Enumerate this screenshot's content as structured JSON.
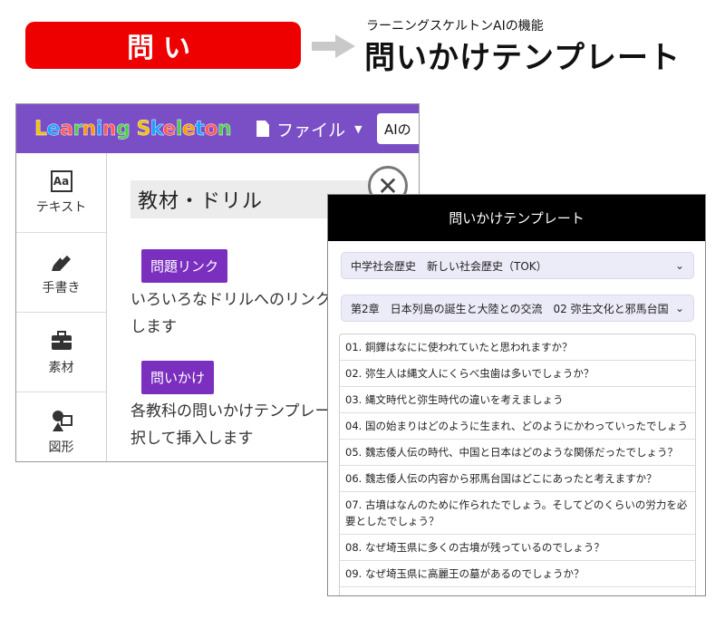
{
  "banner": {
    "pill_label": "問い",
    "subtitle": "ラーニングスケルトンAIの機能",
    "title": "問いかけテンプレート",
    "pill_color": "#ee0000"
  },
  "app": {
    "logo_letters": [
      "L",
      "e",
      "a",
      "r",
      "n",
      "i",
      "n",
      "g",
      " ",
      "S",
      "k",
      "e",
      "l",
      "e",
      "t",
      "o",
      "n"
    ],
    "logo_colors": [
      "#f2c200",
      "#1ea3ff",
      "#ff5a5a",
      "#4cd04c",
      "#ff9b00",
      "#1ea3ff",
      "#ff5a5a",
      "#4cd04c",
      "#ffffff",
      "#f2c200",
      "#1ea3ff",
      "#ff5a5a",
      "#4cd04c",
      "#ff9b00",
      "#1ea3ff",
      "#ff5a5a",
      "#4cd04c"
    ],
    "file_menu": "ファイル",
    "ai_box": "AIの",
    "sidebar": [
      {
        "label": "テキスト",
        "icon": "text-aa-icon"
      },
      {
        "label": "手書き",
        "icon": "pen-icon"
      },
      {
        "label": "素材",
        "icon": "toolbox-icon"
      },
      {
        "label": "図形",
        "icon": "shapes-icon"
      }
    ],
    "section_title": "教材・ドリル",
    "items": [
      {
        "tag": "問題リンク",
        "desc_line1": "いろいろなドリルへのリンクを",
        "desc_line2": "します"
      },
      {
        "tag": "問いかけ",
        "desc_line1": "各教科の問いかけテンプレートを選",
        "desc_line2": "択して挿入します"
      }
    ],
    "accent": "#7a4fc6"
  },
  "panel": {
    "title": "問いかけテンプレート",
    "select1": "中学社会歴史　新しい社会歴史（TOK）",
    "select2": "第2章　日本列島の誕生と大陸との交流　02 弥生文化と邪馬台国",
    "questions": [
      "01. 銅鐸はなにに使われていたと思われますか？",
      "02. 弥生人は縄文人にくらべ虫歯は多いでしょうか？",
      "03. 縄文時代と弥生時代の違いを考えましょう",
      "04. 国の始まりはどのように生まれ、どのようにかわっていったでしょう",
      "05. 魏志倭人伝の時代、中国と日本はどのような関係だったでしょう？",
      "06. 魏志倭人伝の内容から邪馬台国はどこにあったと考えますか？",
      "07. 古墳はなんのために作られたでしょう。そしてどのくらいの労力を必要としたでしょう？",
      "08. なぜ埼玉県に多くの古墳が残っているのでしょう？",
      "09. なぜ埼玉県に高麗王の墓があるのでしょうか？"
    ]
  }
}
